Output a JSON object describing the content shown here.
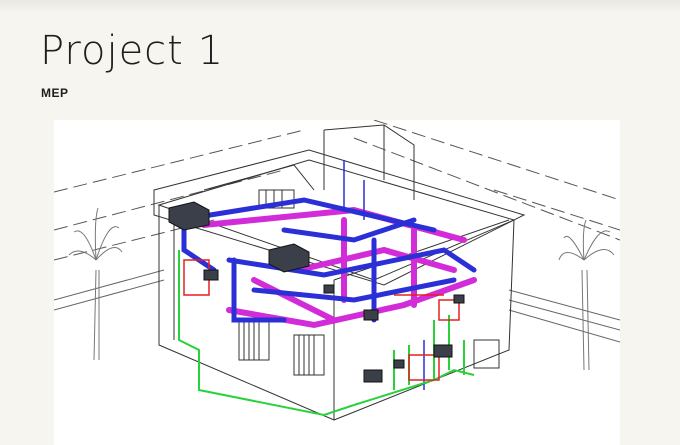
{
  "page": {
    "title": "Project 1",
    "subtitle": "MEP"
  },
  "figure": {
    "icon": "isometric-mep-drawing",
    "colors": {
      "background": "#f6f5ef",
      "linework": "#333333",
      "duct_blue": "#2a2fd6",
      "duct_magenta": "#d22bd8",
      "pipe_green": "#29d23a",
      "pipe_red": "#e32020",
      "equipment": "#3b3f4a"
    }
  }
}
